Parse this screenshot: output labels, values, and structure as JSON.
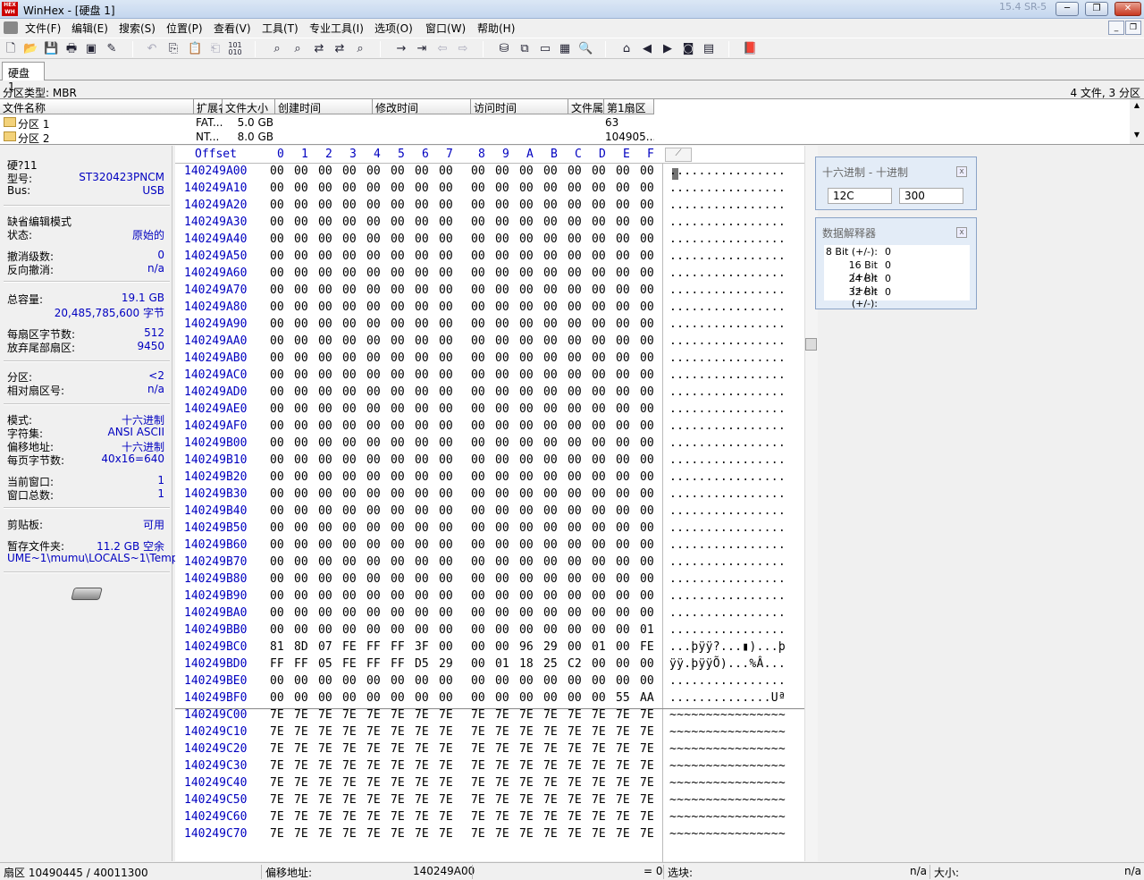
{
  "window": {
    "title": "WinHex - [硬盘 1]",
    "version": "15.4 SR-5",
    "minimize": "─",
    "restore": "❐",
    "close": "✕"
  },
  "menu": [
    "文件(F)",
    "编辑(E)",
    "搜索(S)",
    "位置(P)",
    "查看(V)",
    "工具(T)",
    "专业工具(I)",
    "选项(O)",
    "窗口(W)",
    "帮助(H)"
  ],
  "toolbar_icons": [
    "new-icon",
    "open-icon",
    "save-icon",
    "print-icon",
    "properties-icon",
    "script-icon",
    "undo-icon",
    "copy-icon",
    "paste-icon",
    "paste-block-icon",
    "binary-icon",
    "find-icon",
    "find-hex-icon",
    "replace-icon",
    "replace-hex-icon",
    "find-next-icon",
    "goto-offset-icon",
    "goto-sector-icon",
    "back-icon",
    "forward-icon",
    "disk-tools-icon",
    "clone-icon",
    "drive-icon",
    "calculator-icon",
    "search-icon",
    "snapshot-icon",
    "previous-icon",
    "next-icon",
    "camera-icon",
    "options-icon",
    "help-book-icon"
  ],
  "tab": {
    "label": "硬盘 1"
  },
  "infobar": {
    "left": "分区类型: MBR",
    "right": "4 文件, 3 分区"
  },
  "files": {
    "columns": [
      "文件名称",
      "扩展名",
      "文件大小",
      "创建时间",
      "修改时间",
      "访问时间",
      "文件属性",
      "第1扇区"
    ],
    "rows": [
      {
        "name": "分区 1",
        "ext": "FAT...",
        "size": "5.0 GB",
        "sector": "63"
      },
      {
        "name": "分区 2",
        "ext": "NT...",
        "size": "8.0 GB",
        "sector": "104905..."
      }
    ]
  },
  "left_panel": {
    "disk_label": "硬?11",
    "model_label": "型号:",
    "model": "ST320423PNCM",
    "bus_label": "Bus:",
    "bus": "USB",
    "edit_mode_title": "缺省编辑模式",
    "state_label": "状态:",
    "state": "原始的",
    "undo_level_label": "撤消级数:",
    "undo_level": "0",
    "undo_reverse_label": "反向撤消:",
    "undo_reverse": "n/a",
    "capacity_label": "总容量:",
    "capacity": "19.1 GB",
    "capacity_bytes": "20,485,785,600 字节",
    "bps_label": "每扇区字节数:",
    "bps": "512",
    "discard_label": "放弃尾部扇区:",
    "discard": "9450",
    "partition_label": "分区:",
    "partition": "<2",
    "rel_sector_label": "相对扇区号:",
    "rel_sector": "n/a",
    "mode_label": "模式:",
    "mode": "十六进制",
    "charset_label": "字符集:",
    "charset": "ANSI ASCII",
    "offset_label": "偏移地址:",
    "offset": "十六进制",
    "bpp_label": "每页字节数:",
    "bpp": "40x16=640",
    "cur_win_label": "当前窗口:",
    "cur_win": "1",
    "total_win_label": "窗口总数:",
    "total_win": "1",
    "clipboard_label": "剪贴板:",
    "clipboard": "可用",
    "temp_label": "暂存文件夹:",
    "temp_free": "11.2 GB 空余",
    "temp_path": "UME~1\\mumu\\LOCALS~1\\Temp"
  },
  "hex": {
    "offset_header": "Offset",
    "col_headers": [
      "0",
      "1",
      "2",
      "3",
      "4",
      "5",
      "6",
      "7",
      "8",
      "9",
      "A",
      "B",
      "C",
      "D",
      "E",
      "F"
    ],
    "rows": [
      {
        "off": "140249A00",
        "bytes": "00 00 00 00 00 00 00 00 00 00 00 00 00 00 00 00",
        "ascii": "................"
      },
      {
        "off": "140249A10",
        "bytes": "00 00 00 00 00 00 00 00 00 00 00 00 00 00 00 00",
        "ascii": "................"
      },
      {
        "off": "140249A20",
        "bytes": "00 00 00 00 00 00 00 00 00 00 00 00 00 00 00 00",
        "ascii": "................"
      },
      {
        "off": "140249A30",
        "bytes": "00 00 00 00 00 00 00 00 00 00 00 00 00 00 00 00",
        "ascii": "................"
      },
      {
        "off": "140249A40",
        "bytes": "00 00 00 00 00 00 00 00 00 00 00 00 00 00 00 00",
        "ascii": "................"
      },
      {
        "off": "140249A50",
        "bytes": "00 00 00 00 00 00 00 00 00 00 00 00 00 00 00 00",
        "ascii": "................"
      },
      {
        "off": "140249A60",
        "bytes": "00 00 00 00 00 00 00 00 00 00 00 00 00 00 00 00",
        "ascii": "................"
      },
      {
        "off": "140249A70",
        "bytes": "00 00 00 00 00 00 00 00 00 00 00 00 00 00 00 00",
        "ascii": "................"
      },
      {
        "off": "140249A80",
        "bytes": "00 00 00 00 00 00 00 00 00 00 00 00 00 00 00 00",
        "ascii": "................"
      },
      {
        "off": "140249A90",
        "bytes": "00 00 00 00 00 00 00 00 00 00 00 00 00 00 00 00",
        "ascii": "................"
      },
      {
        "off": "140249AA0",
        "bytes": "00 00 00 00 00 00 00 00 00 00 00 00 00 00 00 00",
        "ascii": "................"
      },
      {
        "off": "140249AB0",
        "bytes": "00 00 00 00 00 00 00 00 00 00 00 00 00 00 00 00",
        "ascii": "................"
      },
      {
        "off": "140249AC0",
        "bytes": "00 00 00 00 00 00 00 00 00 00 00 00 00 00 00 00",
        "ascii": "................"
      },
      {
        "off": "140249AD0",
        "bytes": "00 00 00 00 00 00 00 00 00 00 00 00 00 00 00 00",
        "ascii": "................"
      },
      {
        "off": "140249AE0",
        "bytes": "00 00 00 00 00 00 00 00 00 00 00 00 00 00 00 00",
        "ascii": "................"
      },
      {
        "off": "140249AF0",
        "bytes": "00 00 00 00 00 00 00 00 00 00 00 00 00 00 00 00",
        "ascii": "................"
      },
      {
        "off": "140249B00",
        "bytes": "00 00 00 00 00 00 00 00 00 00 00 00 00 00 00 00",
        "ascii": "................"
      },
      {
        "off": "140249B10",
        "bytes": "00 00 00 00 00 00 00 00 00 00 00 00 00 00 00 00",
        "ascii": "................"
      },
      {
        "off": "140249B20",
        "bytes": "00 00 00 00 00 00 00 00 00 00 00 00 00 00 00 00",
        "ascii": "................"
      },
      {
        "off": "140249B30",
        "bytes": "00 00 00 00 00 00 00 00 00 00 00 00 00 00 00 00",
        "ascii": "................"
      },
      {
        "off": "140249B40",
        "bytes": "00 00 00 00 00 00 00 00 00 00 00 00 00 00 00 00",
        "ascii": "................"
      },
      {
        "off": "140249B50",
        "bytes": "00 00 00 00 00 00 00 00 00 00 00 00 00 00 00 00",
        "ascii": "................"
      },
      {
        "off": "140249B60",
        "bytes": "00 00 00 00 00 00 00 00 00 00 00 00 00 00 00 00",
        "ascii": "................"
      },
      {
        "off": "140249B70",
        "bytes": "00 00 00 00 00 00 00 00 00 00 00 00 00 00 00 00",
        "ascii": "................"
      },
      {
        "off": "140249B80",
        "bytes": "00 00 00 00 00 00 00 00 00 00 00 00 00 00 00 00",
        "ascii": "................"
      },
      {
        "off": "140249B90",
        "bytes": "00 00 00 00 00 00 00 00 00 00 00 00 00 00 00 00",
        "ascii": "................"
      },
      {
        "off": "140249BA0",
        "bytes": "00 00 00 00 00 00 00 00 00 00 00 00 00 00 00 00",
        "ascii": "................"
      },
      {
        "off": "140249BB0",
        "bytes": "00 00 00 00 00 00 00 00 00 00 00 00 00 00 00 01",
        "ascii": "................"
      },
      {
        "off": "140249BC0",
        "bytes": "81 8D 07 FE FF FF 3F 00 00 00 96 29 00 01 00 FE",
        "ascii": "...þÿÿ?...▮)...þ"
      },
      {
        "off": "140249BD0",
        "bytes": "FF FF 05 FE FF FF D5 29 00 01 18 25 C2 00 00 00",
        "ascii": "ÿÿ.þÿÿÕ)...%Â..."
      },
      {
        "off": "140249BE0",
        "bytes": "00 00 00 00 00 00 00 00 00 00 00 00 00 00 00 00",
        "ascii": "................"
      },
      {
        "off": "140249BF0",
        "bytes": "00 00 00 00 00 00 00 00 00 00 00 00 00 00 55 AA",
        "ascii": "..............Uª"
      },
      {
        "off": "140249C00",
        "bytes": "7E 7E 7E 7E 7E 7E 7E 7E 7E 7E 7E 7E 7E 7E 7E 7E",
        "ascii": "~~~~~~~~~~~~~~~~"
      },
      {
        "off": "140249C10",
        "bytes": "7E 7E 7E 7E 7E 7E 7E 7E 7E 7E 7E 7E 7E 7E 7E 7E",
        "ascii": "~~~~~~~~~~~~~~~~"
      },
      {
        "off": "140249C20",
        "bytes": "7E 7E 7E 7E 7E 7E 7E 7E 7E 7E 7E 7E 7E 7E 7E 7E",
        "ascii": "~~~~~~~~~~~~~~~~"
      },
      {
        "off": "140249C30",
        "bytes": "7E 7E 7E 7E 7E 7E 7E 7E 7E 7E 7E 7E 7E 7E 7E 7E",
        "ascii": "~~~~~~~~~~~~~~~~"
      },
      {
        "off": "140249C40",
        "bytes": "7E 7E 7E 7E 7E 7E 7E 7E 7E 7E 7E 7E 7E 7E 7E 7E",
        "ascii": "~~~~~~~~~~~~~~~~"
      },
      {
        "off": "140249C50",
        "bytes": "7E 7E 7E 7E 7E 7E 7E 7E 7E 7E 7E 7E 7E 7E 7E 7E",
        "ascii": "~~~~~~~~~~~~~~~~"
      },
      {
        "off": "140249C60",
        "bytes": "7E 7E 7E 7E 7E 7E 7E 7E 7E 7E 7E 7E 7E 7E 7E 7E",
        "ascii": "~~~~~~~~~~~~~~~~"
      },
      {
        "off": "140249C70",
        "bytes": "7E 7E 7E 7E 7E 7E 7E 7E 7E 7E 7E 7E 7E 7E 7E 7E",
        "ascii": "~~~~~~~~~~~~~~~~"
      }
    ]
  },
  "hex_dec_panel": {
    "title": "十六进制 - 十进制",
    "hex_value": "12C",
    "dec_value": "300",
    "close": "x"
  },
  "interpreter_panel": {
    "title": "数据解释器",
    "close": "x",
    "rows": [
      {
        "label": "8 Bit (+/-):",
        "value": "0"
      },
      {
        "label": "16 Bit (+/-):",
        "value": "0"
      },
      {
        "label": "24 Bit (+/-):",
        "value": "0"
      },
      {
        "label": "32 Bit (+/-):",
        "value": "0"
      }
    ]
  },
  "status": {
    "sector": "扇区 10490445 / 40011300",
    "offset_label": "偏移地址:",
    "offset_value": "140249A00",
    "value": "= 0",
    "selection_label": "选块:",
    "selection_value": "n/a",
    "size_label": "大小:",
    "size_value": "n/a"
  },
  "colors": {
    "offset_blue": "#0000c0",
    "title_grad_top": "#dbe7f5",
    "title_grad_bottom": "#c4d6ee"
  }
}
